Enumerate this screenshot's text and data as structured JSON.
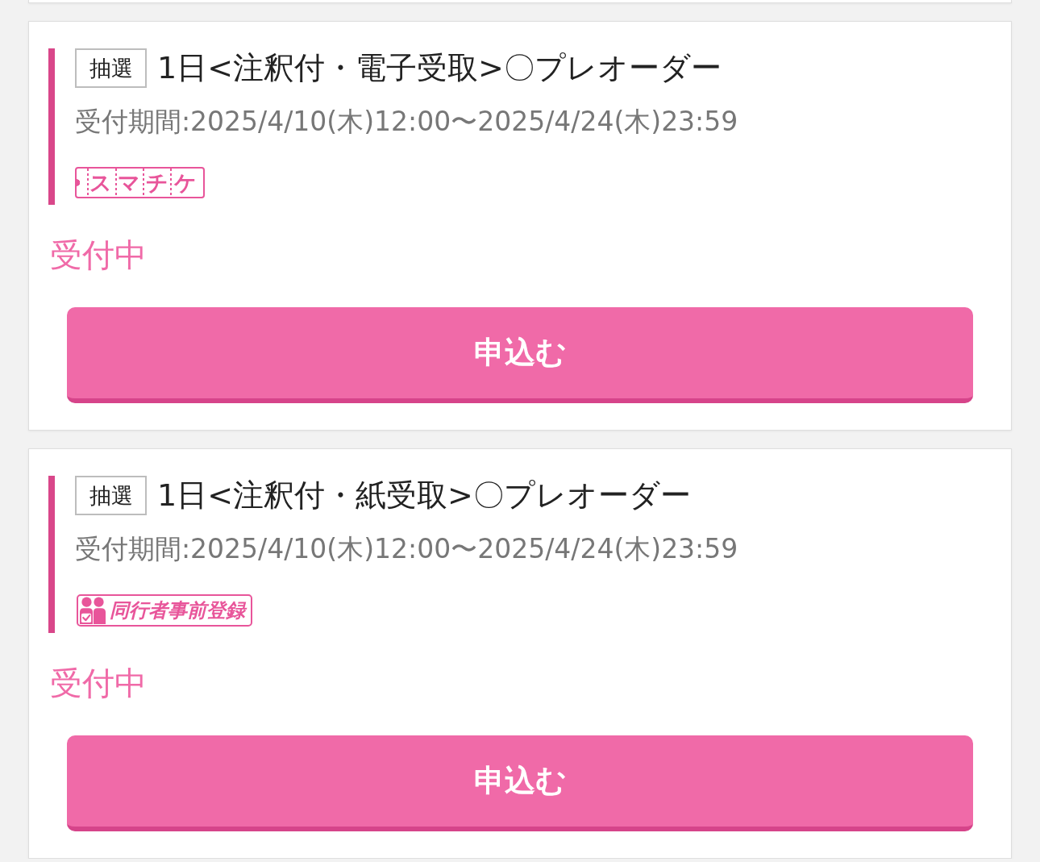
{
  "sales": [
    {
      "method": "抽選",
      "title": "1日<注釈付・電子受取>〇プレオーダー",
      "period": "受付期間:2025/4/10(木)12:00〜2025/4/24(木)23:59",
      "feature": {
        "kind": "smart_ticket",
        "label": "スマチケ"
      },
      "status": "受付中",
      "button": "申込む"
    },
    {
      "method": "抽選",
      "title": "1日<注釈付・紙受取>〇プレオーダー",
      "period": "受付期間:2025/4/10(木)12:00〜2025/4/24(木)23:59",
      "feature": {
        "kind": "companion_registration",
        "label": "同行者事前登録"
      },
      "status": "受付中",
      "button": "申込む"
    }
  ]
}
